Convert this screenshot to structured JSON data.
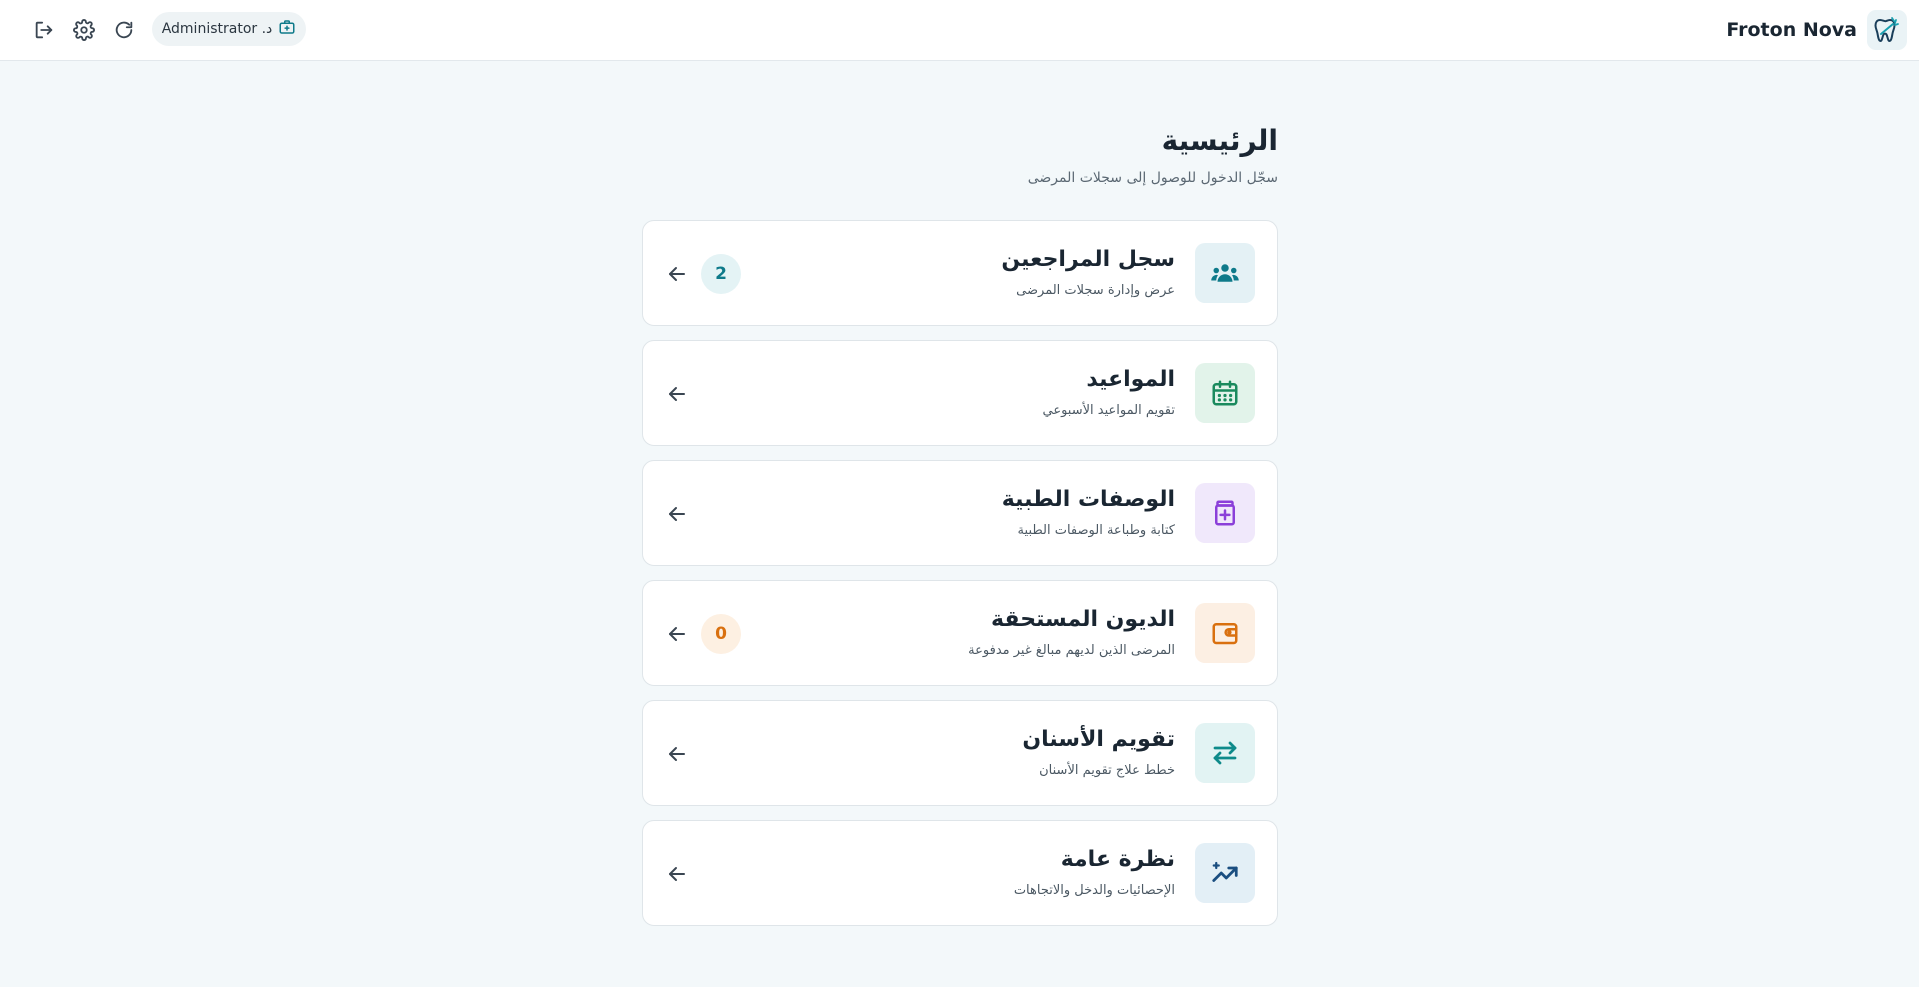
{
  "topbar": {
    "user_label": "د. Administrator",
    "brand_name": "Froton Nova",
    "icons": [
      "logout-icon",
      "gear-icon",
      "refresh-icon",
      "briefcase-icon"
    ]
  },
  "main": {
    "title": "الرئيسية",
    "subtitle": "سجّل الدخول للوصول إلى سجلات المرضى"
  },
  "cards": [
    {
      "title": "سجل المراجعين",
      "desc": "عرض وإدارة سجلات المرضى",
      "badge": "2",
      "icon": "users-icon",
      "icon_color": "#0e7a8a",
      "icon_bg": "#e4f1f5",
      "badge_bg": "#e4f3f5",
      "badge_color": "#0e7a8a"
    },
    {
      "title": "المواعيد",
      "desc": "تقويم المواعيد الأسبوعي",
      "icon": "calendar-icon",
      "icon_color": "#1a8a5e",
      "icon_bg": "#e2f3ea"
    },
    {
      "title": "الوصفات الطبية",
      "desc": "كتابة وطباعة الوصفات الطبية",
      "icon": "medicine-icon",
      "icon_color": "#8b3fd9",
      "icon_bg": "#f0e8fb"
    },
    {
      "title": "الديون المستحقة",
      "desc": "المرضى الذين لديهم مبالغ غير مدفوعة",
      "badge": "0",
      "icon": "wallet-icon",
      "icon_color": "#d9700f",
      "icon_bg": "#fcefe3",
      "badge_bg": "#fdf0e2",
      "badge_color": "#d9700f"
    },
    {
      "title": "تقويم الأسنان",
      "desc": "خطط علاج تقويم الأسنان",
      "icon": "swap-arrows-icon",
      "icon_color": "#0e8a8a",
      "icon_bg": "#e2f3f3"
    },
    {
      "title": "نظرة عامة",
      "desc": "الإحصائيات والدخل والاتجاهات",
      "icon": "trend-chart-icon",
      "icon_color": "#1a4e80",
      "icon_bg": "#e3eff6"
    }
  ]
}
